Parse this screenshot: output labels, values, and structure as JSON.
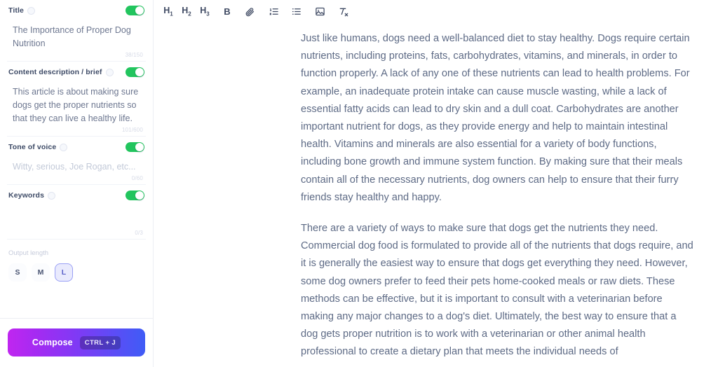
{
  "sidebar": {
    "fields": [
      {
        "label": "Title",
        "icon": "info-icon",
        "toggle_on": true,
        "value": "The Importance of Proper Dog Nutrition",
        "is_placeholder": false,
        "counter": "38/150"
      },
      {
        "label": "Content description / brief",
        "icon": "info-icon",
        "toggle_on": true,
        "value": "This article is about making sure dogs get the proper nutrients so that they can live a healthy life.",
        "is_placeholder": false,
        "counter": "101/600"
      },
      {
        "label": "Tone of voice",
        "icon": "info-icon",
        "toggle_on": true,
        "value": "Witty, serious, Joe Rogan, etc...",
        "is_placeholder": true,
        "counter": "0/60"
      },
      {
        "label": "Keywords",
        "icon": "info-icon",
        "toggle_on": true,
        "value": "",
        "is_placeholder": true,
        "counter": "0/3"
      }
    ],
    "output_length": {
      "title": "Output length",
      "options": [
        "S",
        "M",
        "L"
      ],
      "selected": "L"
    },
    "compose": {
      "label": "Compose",
      "shortcut": "CTRL + J",
      "gradient_from": "#c026f0",
      "gradient_to": "#3f5cf6"
    },
    "toggle_color": "#22c55e",
    "accent_color": "#9aa0f5"
  },
  "editor": {
    "toolbar": [
      {
        "name": "heading-1-button",
        "label": "H",
        "sub": "1",
        "type": "heading"
      },
      {
        "name": "heading-2-button",
        "label": "H",
        "sub": "2",
        "type": "heading"
      },
      {
        "name": "heading-3-button",
        "label": "H",
        "sub": "3",
        "type": "heading"
      },
      {
        "name": "bold-button",
        "label": "B",
        "sub": "",
        "type": "bold"
      },
      {
        "name": "link-icon",
        "label": "",
        "sub": "",
        "type": "link"
      },
      {
        "name": "ordered-list-button",
        "label": "",
        "sub": "",
        "type": "ol"
      },
      {
        "name": "unordered-list-button",
        "label": "",
        "sub": "",
        "type": "ul"
      },
      {
        "name": "image-button",
        "label": "",
        "sub": "",
        "type": "image"
      },
      {
        "name": "clear-formatting-button",
        "label": "",
        "sub": "",
        "type": "clear"
      }
    ],
    "paragraphs": [
      "Just like humans, dogs need a well-balanced diet to stay healthy. Dogs require certain nutrients, including proteins, fats, carbohydrates, vitamins, and minerals, in order to function properly. A lack of any one of these nutrients can lead to health problems. For example, an inadequate protein intake can cause muscle wasting, while a lack of essential fatty acids can lead to dry skin and a dull coat. Carbohydrates are another important nutrient for dogs, as they provide energy and help to maintain intestinal health. Vitamins and minerals are also essential for a variety of body functions, including bone growth and immune system function. By making sure that their meals contain all of the necessary nutrients, dog owners can help to ensure that their furry friends stay healthy and happy.",
      "There are a variety of ways to make sure that dogs get the nutrients they need. Commercial dog food is formulated to provide all of the nutrients that dogs require, and it is generally the easiest way to ensure that dogs get everything they need. However, some dog owners prefer to feed their pets home-cooked meals or raw diets. These methods can be effective, but it is important to consult with a veterinarian before making any major changes to a dog's diet. Ultimately, the best way to ensure that a dog gets proper nutrition is to work with a veterinarian or other animal health professional to create a dietary plan that meets the individual needs of"
    ],
    "text_color": "#5d6a85"
  }
}
